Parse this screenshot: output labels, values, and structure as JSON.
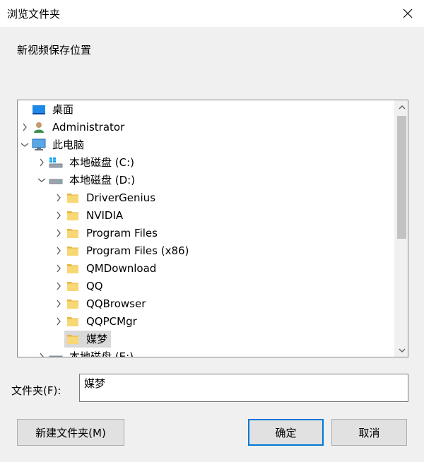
{
  "window": {
    "title": "浏览文件夹"
  },
  "prompt": "新视频保存位置",
  "tree": [
    {
      "label": "桌面",
      "icon": "desktop-icon",
      "indent": 0,
      "chevron": "none"
    },
    {
      "label": "Administrator",
      "icon": "user-icon",
      "indent": 0,
      "chevron": "right"
    },
    {
      "label": "此电脑",
      "icon": "computer-icon",
      "indent": 0,
      "chevron": "down"
    },
    {
      "label": "本地磁盘 (C:)",
      "icon": "system-drive-icon",
      "indent": 1,
      "chevron": "right"
    },
    {
      "label": "本地磁盘 (D:)",
      "icon": "drive-icon",
      "indent": 1,
      "chevron": "down"
    },
    {
      "label": "DriverGenius",
      "icon": "folder-icon",
      "indent": 2,
      "chevron": "right"
    },
    {
      "label": "NVIDIA",
      "icon": "folder-icon",
      "indent": 2,
      "chevron": "right"
    },
    {
      "label": "Program Files",
      "icon": "folder-icon",
      "indent": 2,
      "chevron": "right"
    },
    {
      "label": "Program Files (x86)",
      "icon": "folder-icon",
      "indent": 2,
      "chevron": "right"
    },
    {
      "label": "QMDownload",
      "icon": "folder-icon",
      "indent": 2,
      "chevron": "right"
    },
    {
      "label": "QQ",
      "icon": "folder-icon",
      "indent": 2,
      "chevron": "right"
    },
    {
      "label": "QQBrowser",
      "icon": "folder-icon",
      "indent": 2,
      "chevron": "right"
    },
    {
      "label": "QQPCMgr",
      "icon": "folder-icon",
      "indent": 2,
      "chevron": "right"
    },
    {
      "label": "媒梦",
      "icon": "folder-icon",
      "indent": 2,
      "chevron": "none",
      "selected": true
    },
    {
      "label": "本地磁盘 (E:)",
      "icon": "drive-icon",
      "indent": 1,
      "chevron": "right"
    }
  ],
  "folder_field": {
    "label": "文件夹(F):",
    "value": "媒梦"
  },
  "buttons": {
    "new_folder": "新建文件夹(M)",
    "ok": "确定",
    "cancel": "取消"
  },
  "colors": {
    "accent": "#0078d7",
    "folder": "#f8d775",
    "selection": "#d9d9d9"
  }
}
